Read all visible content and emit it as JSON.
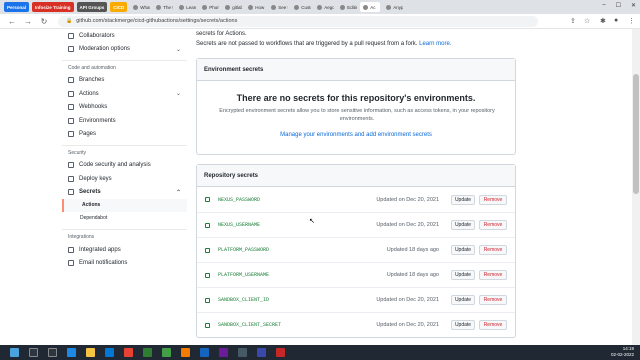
{
  "browser": {
    "tabs": [
      {
        "label": "Personal",
        "color": "#1a73e8"
      },
      {
        "label": "Infosize Training",
        "color": "#d93025"
      },
      {
        "label": "API Groups",
        "color": "#555555"
      },
      {
        "label": "CICD",
        "color": "#f9ab00"
      },
      {
        "label": "What"
      },
      {
        "label": "The 9"
      },
      {
        "label": "Learn"
      },
      {
        "label": "Phome"
      },
      {
        "label": "gitlab"
      },
      {
        "label": "How t"
      },
      {
        "label": "See fo"
      },
      {
        "label": "Custo"
      },
      {
        "label": "Aegon"
      },
      {
        "label": "Editin"
      },
      {
        "label": "Ac"
      },
      {
        "label": "Anypo"
      }
    ],
    "url": "github.com/stackmerge/cicd-githubactions/settings/secrets/actions"
  },
  "sidebar": {
    "top_items": [
      {
        "label": "Collaborators"
      },
      {
        "label": "Moderation options",
        "chevron": "⌄"
      }
    ],
    "automation_heading": "Code and automation",
    "automation_items": [
      {
        "label": "Branches"
      },
      {
        "label": "Actions",
        "chevron": "⌄"
      },
      {
        "label": "Webhooks"
      },
      {
        "label": "Environments"
      },
      {
        "label": "Pages"
      }
    ],
    "security_heading": "Security",
    "security_items": [
      {
        "label": "Code security and analysis"
      },
      {
        "label": "Deploy keys"
      },
      {
        "label": "Secrets",
        "chevron": "⌃"
      }
    ],
    "secrets_sub": [
      {
        "label": "Actions"
      },
      {
        "label": "Dependabot"
      }
    ],
    "integrations_heading": "Integrations",
    "integrations_items": [
      {
        "label": "Integrated apps"
      },
      {
        "label": "Email notifications"
      }
    ]
  },
  "main": {
    "intro_line1": "secrets for Actions.",
    "intro_line2": "Secrets are not passed to workflows that are triggered by a pull request from a fork.",
    "learn_more": "Learn more.",
    "env_box": {
      "title": "Environment secrets",
      "empty_title": "There are no secrets for this repository's environments.",
      "empty_desc": "Encrypted environment secrets allow you to store sensitive information, such as access tokens, in your repository environments.",
      "manage_link": "Manage your environments and add environment secrets"
    },
    "repo_box": {
      "title": "Repository secrets",
      "update_label": "Update",
      "remove_label": "Remove",
      "secrets": [
        {
          "name": "NEXUS_PASSWORD",
          "updated": "Updated on Dec 20, 2021"
        },
        {
          "name": "NEXUS_USERNAME",
          "updated": "Updated on Dec 20, 2021"
        },
        {
          "name": "PLATFORM_PASSWORD",
          "updated": "Updated 18 days ago"
        },
        {
          "name": "PLATFORM_USERNAME",
          "updated": "Updated 18 days ago"
        },
        {
          "name": "SANDBOX_CLIENT_ID",
          "updated": "Updated on Dec 20, 2021"
        },
        {
          "name": "SANDBOX_CLIENT_SECRET",
          "updated": "Updated on Dec 20, 2021"
        }
      ]
    }
  },
  "taskbar": {
    "time": "14:19",
    "date": "02-02-2022"
  }
}
